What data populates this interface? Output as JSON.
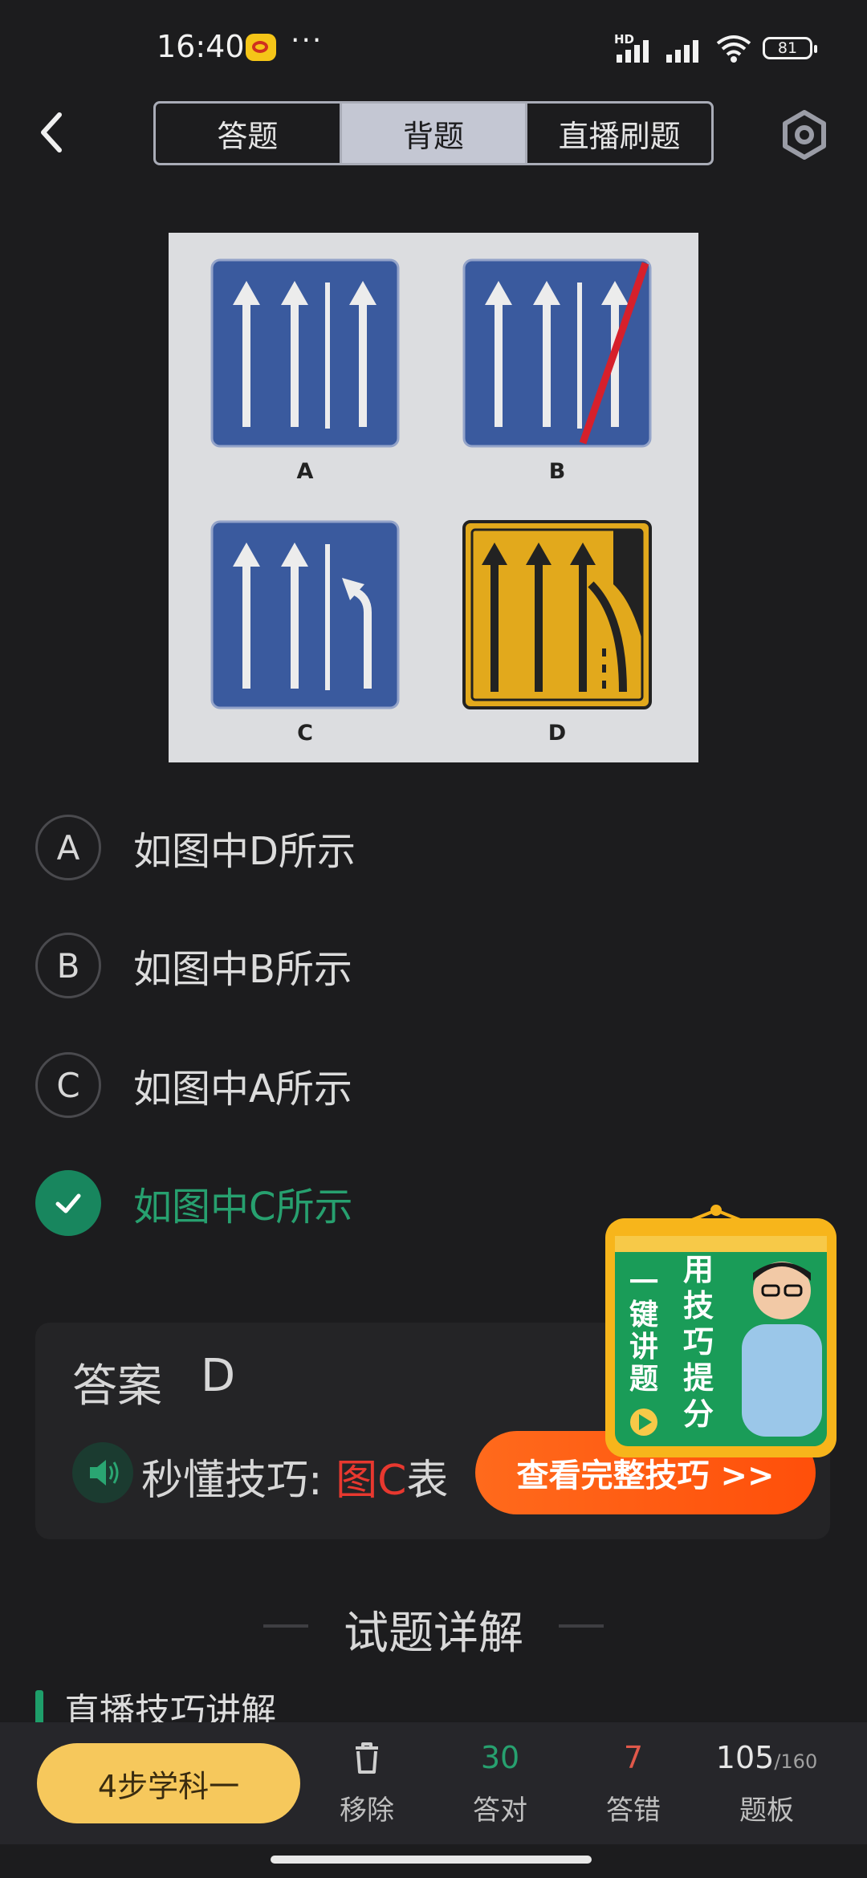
{
  "status_bar": {
    "time": "16:40",
    "more": "···",
    "network_label": "HD",
    "battery": "81"
  },
  "header": {
    "tabs": [
      "答题",
      "背题",
      "直播刷题"
    ],
    "active_tab": "背题"
  },
  "question_image": {
    "labels": [
      "A",
      "B",
      "C",
      "D"
    ]
  },
  "options": [
    {
      "letter": "A",
      "text": "如图中D所示",
      "correct": false
    },
    {
      "letter": "B",
      "text": "如图中B所示",
      "correct": false
    },
    {
      "letter": "C",
      "text": "如图中A所示",
      "correct": false
    },
    {
      "letter": "",
      "text": "如图中C所示",
      "correct": true
    }
  ],
  "answer": {
    "label": "答案",
    "value": "D",
    "tip_prefix": "秒懂技巧: ",
    "tip_highlight": "图C",
    "tip_rest": "表",
    "tip_button": "查看完整技巧 >>"
  },
  "promo": {
    "left_text": "一键讲题",
    "right_text": "用技巧提分"
  },
  "details": {
    "title": "试题详解",
    "subsection": "直播技巧讲解"
  },
  "bottom_bar": {
    "learn_button": "4步学科一",
    "remove_label": "移除",
    "correct_count": "30",
    "correct_label": "答对",
    "wrong_count": "7",
    "wrong_label": "答错",
    "board_count": "105",
    "board_total": "/160",
    "board_label": "题板"
  },
  "colors": {
    "correct_green": "#27a06f",
    "wrong_red": "#e0584a",
    "accent_orange": "#ff5a12",
    "learn_yellow": "#f6c85c"
  }
}
